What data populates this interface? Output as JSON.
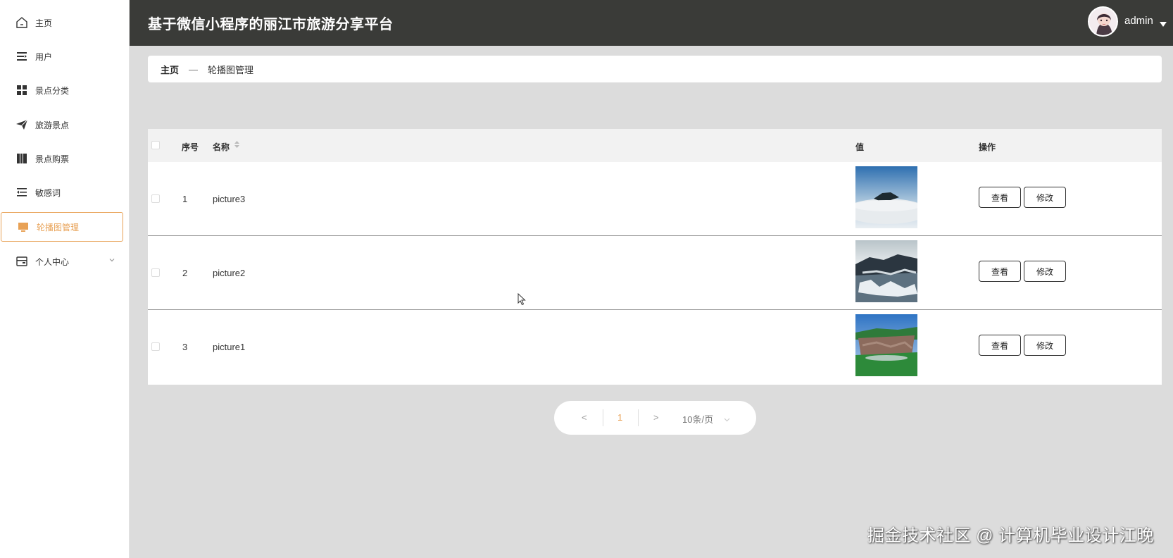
{
  "sidebar": {
    "items": [
      {
        "label": "主页",
        "icon": "home-icon"
      },
      {
        "label": "用户",
        "icon": "user-list-icon"
      },
      {
        "label": "景点分类",
        "icon": "grid-icon"
      },
      {
        "label": "旅游景点",
        "icon": "paper-plane-icon"
      },
      {
        "label": "景点购票",
        "icon": "books-icon"
      },
      {
        "label": "敏感词",
        "icon": "indent-list-icon"
      },
      {
        "label": "轮播图管理",
        "icon": "monitor-icon"
      },
      {
        "label": "个人中心",
        "icon": "card-icon"
      }
    ]
  },
  "header": {
    "title": "基于微信小程序的丽江市旅游分享平台",
    "username": "admin"
  },
  "breadcrumb": {
    "home": "主页",
    "separator": "—",
    "current": "轮播图管理"
  },
  "table": {
    "columns": {
      "index": "序号",
      "name": "名称",
      "value": "值",
      "actions": "操作"
    },
    "rows": [
      {
        "index": "1",
        "name": "picture3",
        "view": "查看",
        "edit": "修改"
      },
      {
        "index": "2",
        "name": "picture2",
        "view": "查看",
        "edit": "修改"
      },
      {
        "index": "3",
        "name": "picture1",
        "view": "查看",
        "edit": "修改"
      }
    ]
  },
  "pagination": {
    "prev": "<",
    "current_page": "1",
    "next": ">",
    "page_size": "10条/页"
  },
  "watermark": "掘金技术社区 @ 计算机毕业设计江晚",
  "colors": {
    "accent": "#e8a155",
    "header_bg": "#3a3b38",
    "page_bg": "#dcdcdc"
  }
}
